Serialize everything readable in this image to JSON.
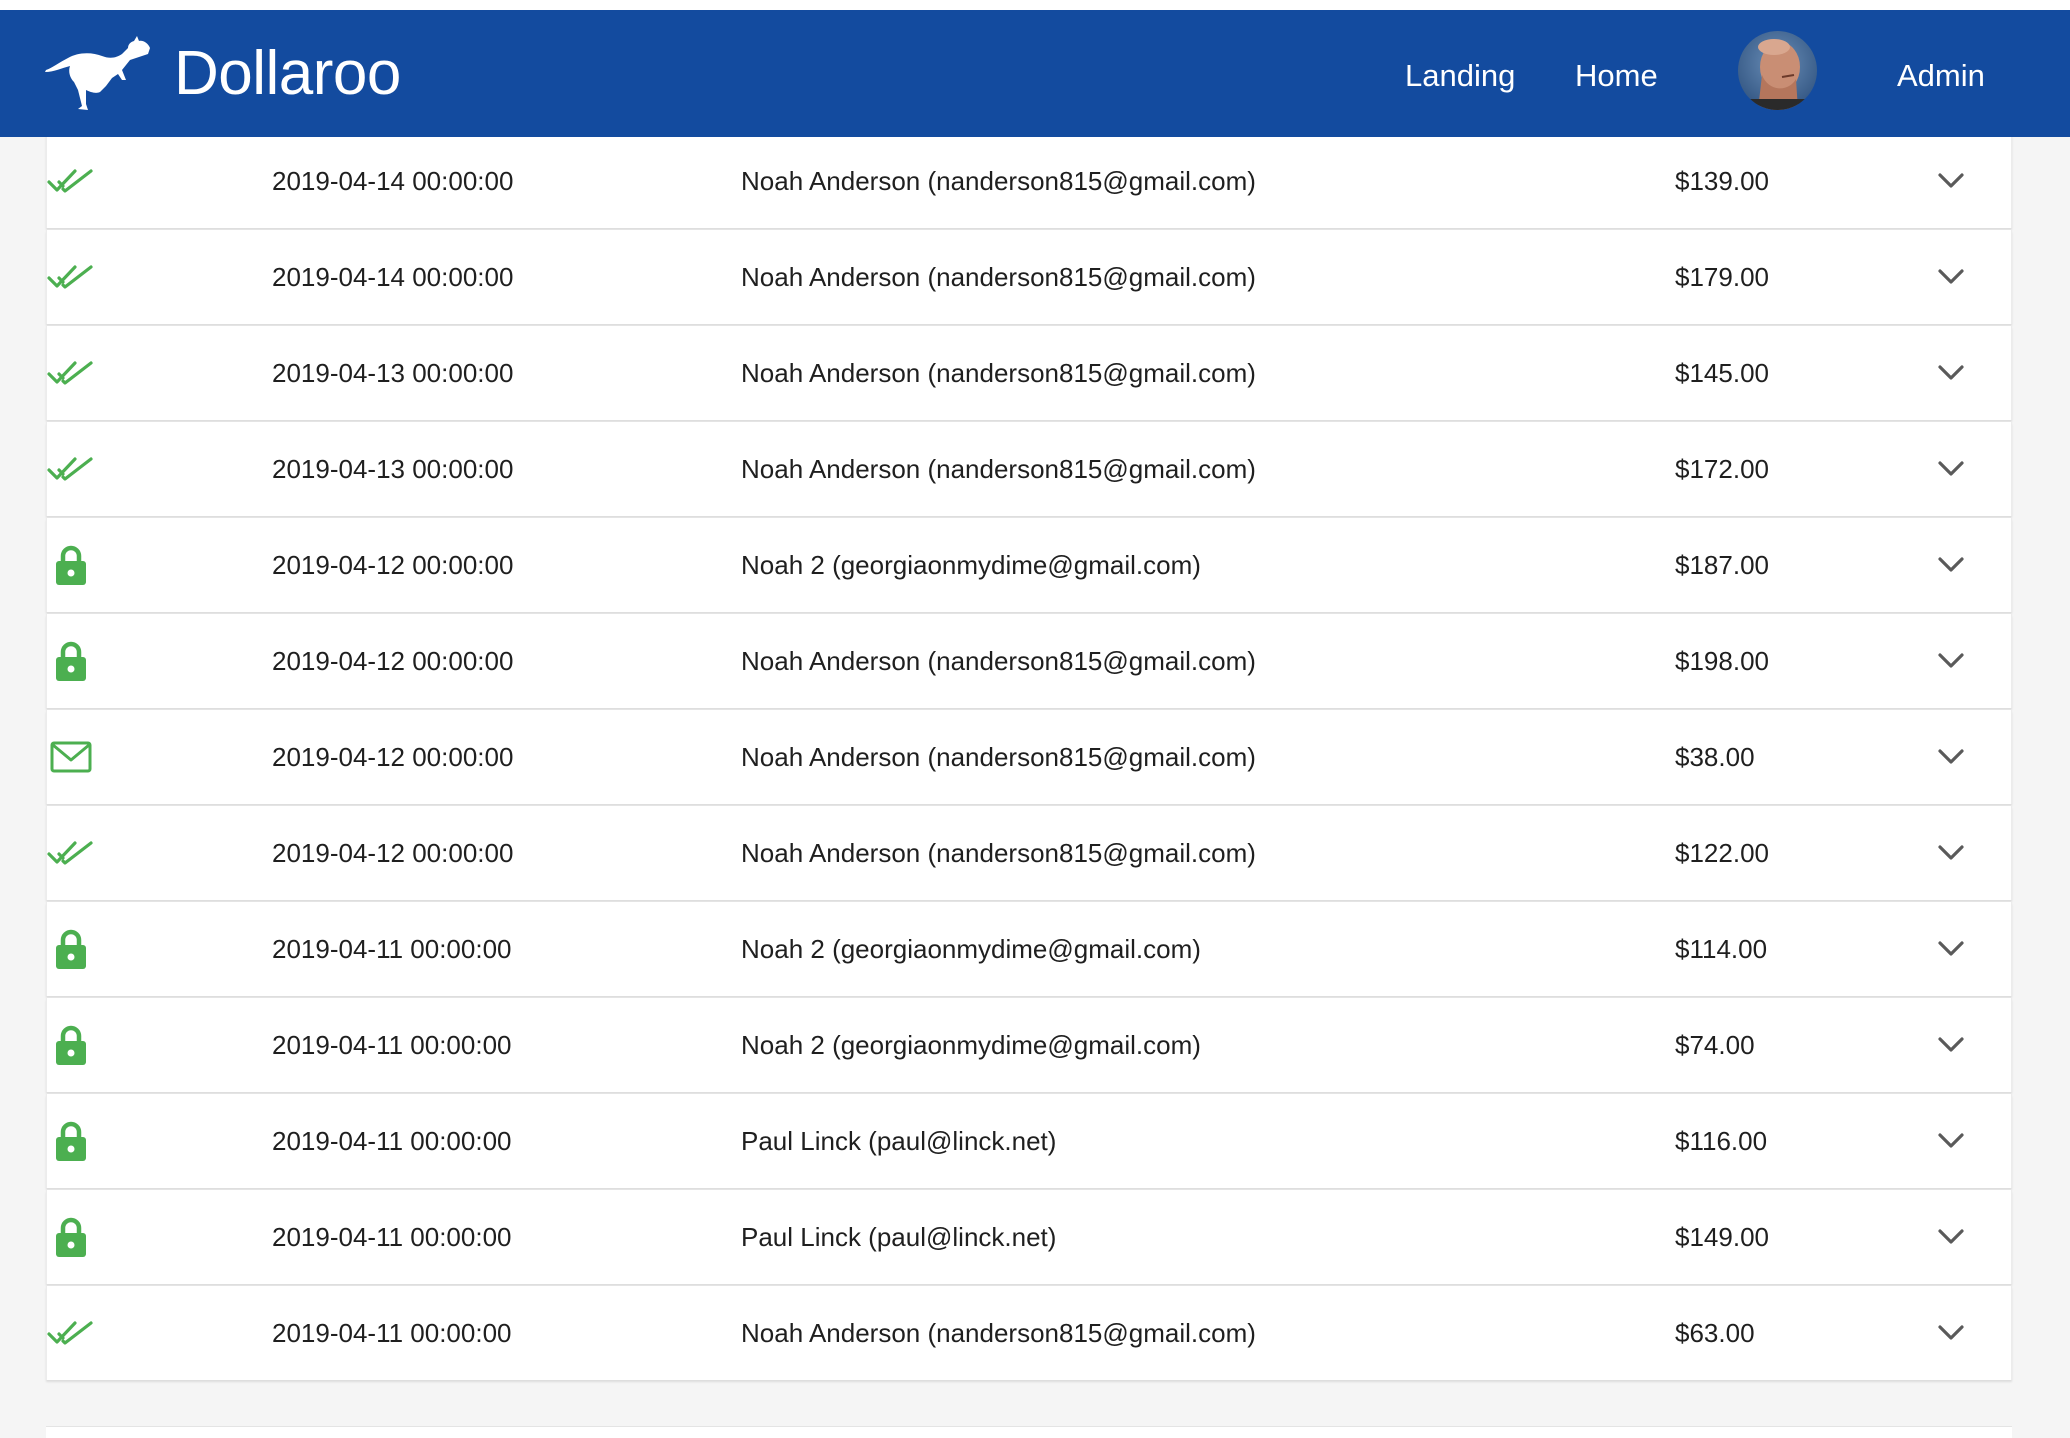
{
  "app": {
    "name": "Dollaroo"
  },
  "nav": {
    "links": [
      "Landing",
      "Home",
      "Admin"
    ]
  },
  "colors": {
    "navbar": "#134b9f",
    "status_green": "#4caf50",
    "text": "#1f1f1f"
  },
  "transactions": [
    {
      "status": "lock",
      "date": "",
      "customer": "",
      "amount": ""
    },
    {
      "status": "double-check",
      "date": "2019-04-14 00:00:00",
      "customer": "Noah Anderson (nanderson815@gmail.com)",
      "amount": "$139.00"
    },
    {
      "status": "double-check",
      "date": "2019-04-14 00:00:00",
      "customer": "Noah Anderson (nanderson815@gmail.com)",
      "amount": "$179.00"
    },
    {
      "status": "double-check",
      "date": "2019-04-13 00:00:00",
      "customer": "Noah Anderson (nanderson815@gmail.com)",
      "amount": "$145.00"
    },
    {
      "status": "double-check",
      "date": "2019-04-13 00:00:00",
      "customer": "Noah Anderson (nanderson815@gmail.com)",
      "amount": "$172.00"
    },
    {
      "status": "lock",
      "date": "2019-04-12 00:00:00",
      "customer": "Noah 2 (georgiaonmydime@gmail.com)",
      "amount": "$187.00"
    },
    {
      "status": "lock",
      "date": "2019-04-12 00:00:00",
      "customer": "Noah Anderson (nanderson815@gmail.com)",
      "amount": "$198.00"
    },
    {
      "status": "envelope",
      "date": "2019-04-12 00:00:00",
      "customer": "Noah Anderson (nanderson815@gmail.com)",
      "amount": "$38.00"
    },
    {
      "status": "double-check",
      "date": "2019-04-12 00:00:00",
      "customer": "Noah Anderson (nanderson815@gmail.com)",
      "amount": "$122.00"
    },
    {
      "status": "lock",
      "date": "2019-04-11 00:00:00",
      "customer": "Noah 2 (georgiaonmydime@gmail.com)",
      "amount": "$114.00"
    },
    {
      "status": "lock",
      "date": "2019-04-11 00:00:00",
      "customer": "Noah 2 (georgiaonmydime@gmail.com)",
      "amount": "$74.00"
    },
    {
      "status": "lock",
      "date": "2019-04-11 00:00:00",
      "customer": "Paul Linck (paul@linck.net)",
      "amount": "$116.00"
    },
    {
      "status": "lock",
      "date": "2019-04-11 00:00:00",
      "customer": "Paul Linck (paul@linck.net)",
      "amount": "$149.00"
    },
    {
      "status": "double-check",
      "date": "2019-04-11 00:00:00",
      "customer": "Noah Anderson (nanderson815@gmail.com)",
      "amount": "$63.00"
    }
  ]
}
